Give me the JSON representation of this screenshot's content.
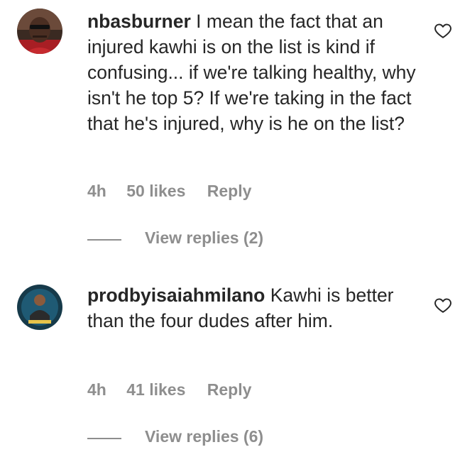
{
  "comments": [
    {
      "username": "nbasburner",
      "text": "I mean the fact that an injured kawhi is on the list is kind if confusing... if we're talking healthy, why isn't he top 5? If we're taking in the fact that he's injured, why is he on the list?",
      "time": "4h",
      "likes": "50 likes",
      "reply_label": "Reply",
      "view_replies": "View replies (2)",
      "like_icon": "heart-outline-icon"
    },
    {
      "username": "prodbyisaiahmilano",
      "text": "Kawhi is better than the four dudes after him.",
      "time": "4h",
      "likes": "41 likes",
      "reply_label": "Reply",
      "view_replies": "View replies (6)",
      "like_icon": "heart-outline-icon"
    }
  ],
  "colors": {
    "text": "#262626",
    "muted": "#8e8e8e",
    "background": "#ffffff"
  }
}
